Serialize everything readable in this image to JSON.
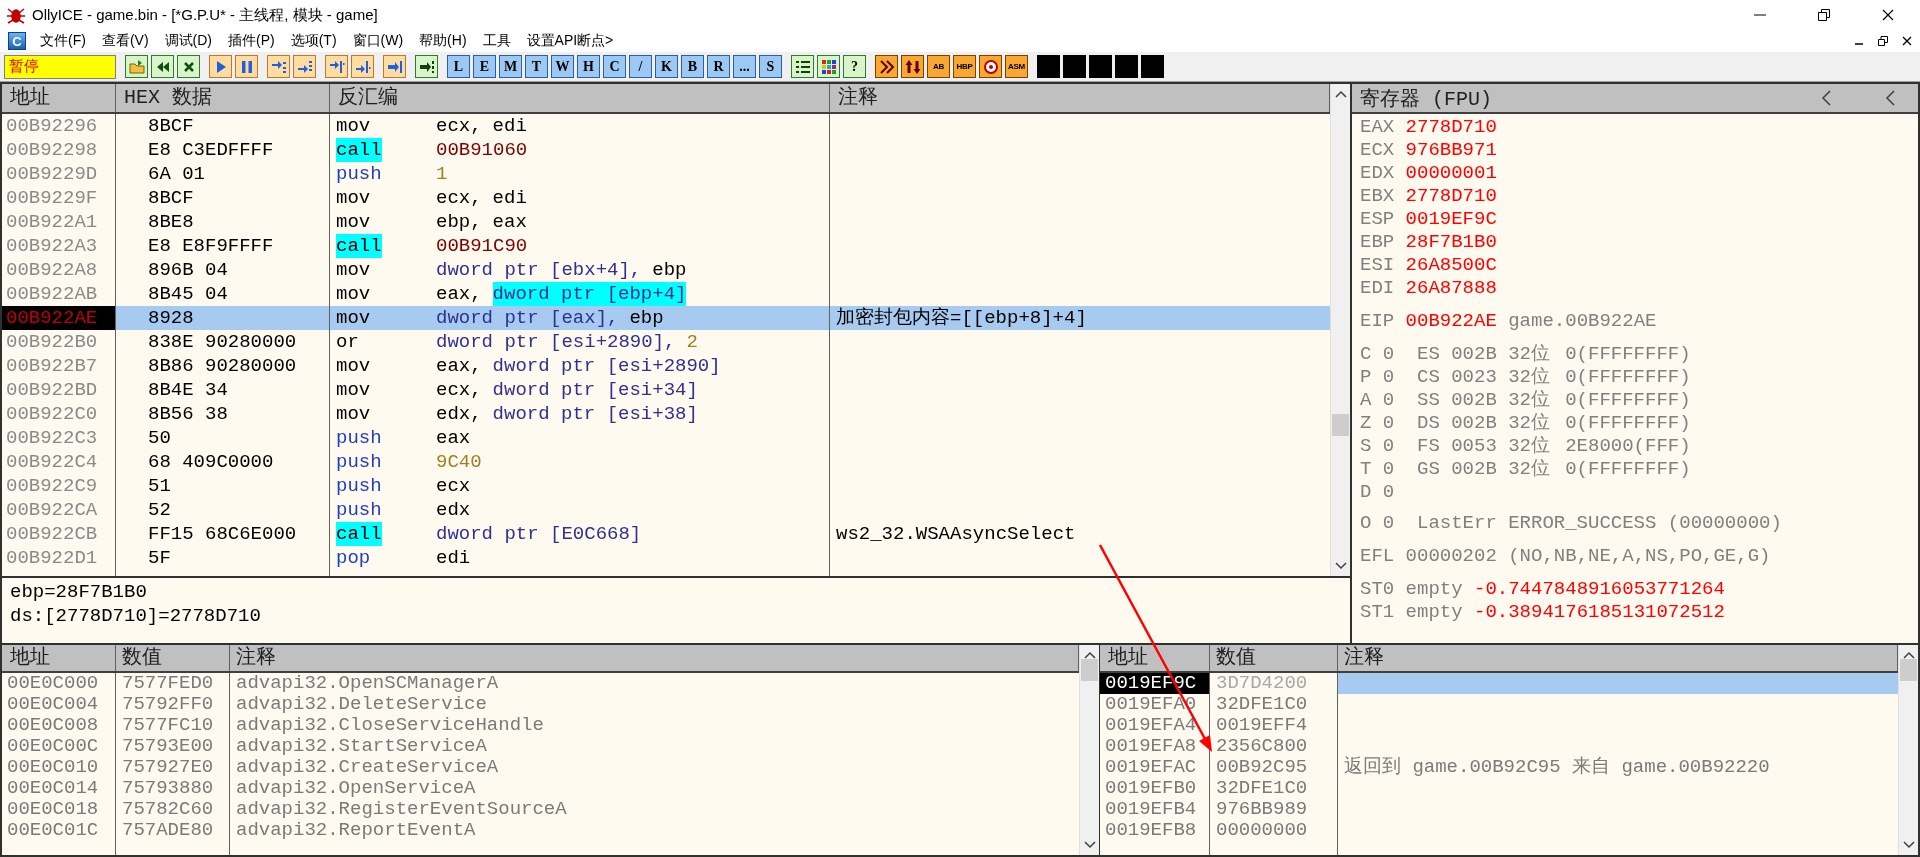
{
  "window": {
    "title": "OllyICE - game.bin - [*G.P.U* - 主线程, 模块 - game]"
  },
  "menu": {
    "window_icon_label": "C",
    "items": [
      {
        "label": "文件(F)"
      },
      {
        "label": "查看(V)"
      },
      {
        "label": "调试(D)"
      },
      {
        "label": "插件(P)"
      },
      {
        "label": "选项(T)"
      },
      {
        "label": "窗口(W)"
      },
      {
        "label": "帮助(H)"
      },
      {
        "label": "工具"
      },
      {
        "label": "设置API断点>"
      }
    ]
  },
  "toolbar": {
    "status": "暂停",
    "groups": [
      {
        "buttons": [
          {
            "kind": "icon"
          },
          {
            "kind": "icon"
          },
          {
            "kind": "icon"
          }
        ]
      },
      {
        "buttons": [
          {
            "kind": "icon"
          },
          {
            "kind": "icon"
          }
        ]
      },
      {
        "buttons": [
          {
            "kind": "icon"
          },
          {
            "kind": "icon"
          }
        ]
      },
      {
        "buttons": [
          {
            "kind": "icon"
          },
          {
            "kind": "icon"
          }
        ]
      },
      {
        "buttons": [
          {
            "kind": "icon"
          }
        ]
      },
      {
        "buttons": [
          {
            "kind": "icon"
          }
        ]
      },
      {
        "buttons": [
          {
            "kind": "letter",
            "label": "L"
          },
          {
            "kind": "letter",
            "label": "E"
          },
          {
            "kind": "letter",
            "label": "M"
          },
          {
            "kind": "letter",
            "label": "T"
          },
          {
            "kind": "letter",
            "label": "W"
          },
          {
            "kind": "letter",
            "label": "H"
          },
          {
            "kind": "letter",
            "label": "C"
          },
          {
            "kind": "letter",
            "label": "/"
          },
          {
            "kind": "letter",
            "label": "K"
          },
          {
            "kind": "letter",
            "label": "B"
          },
          {
            "kind": "letter",
            "label": "R"
          },
          {
            "kind": "letter",
            "label": "..."
          },
          {
            "kind": "letter",
            "label": "S"
          }
        ]
      },
      {
        "buttons": [
          {
            "kind": "icon"
          },
          {
            "kind": "icon"
          },
          {
            "kind": "letter",
            "label": "?"
          }
        ]
      },
      {
        "buttons": [
          {
            "kind": "icon"
          },
          {
            "kind": "icon"
          },
          {
            "kind": "small_letter",
            "label": "AB"
          },
          {
            "kind": "small_letter",
            "label": "HBP"
          },
          {
            "kind": "icon"
          },
          {
            "kind": "small_letter",
            "label": "ASM"
          }
        ]
      },
      {
        "buttons": [
          {
            "kind": "blank"
          },
          {
            "kind": "blank"
          },
          {
            "kind": "blank"
          },
          {
            "kind": "blank"
          },
          {
            "kind": "blank"
          }
        ]
      }
    ]
  },
  "disassembly": {
    "columns": [
      "地址",
      "HEX 数据",
      "反汇编",
      "注释"
    ],
    "rows": [
      {
        "address": "00B92296",
        "hex": "8BCF",
        "mnemonic": "mov",
        "kind": "plain",
        "operands": [
          {
            "text": "ecx,",
            "kind": "reg"
          },
          {
            "text": "edi",
            "kind": "reg"
          }
        ],
        "selected": false,
        "current": false
      },
      {
        "address": "00B92298",
        "hex": "E8 C3EDFFFF",
        "mnemonic": "call",
        "kind": "call",
        "operands": [
          {
            "text": "00B91060",
            "kind": "target"
          }
        ],
        "selected": false,
        "current": false
      },
      {
        "address": "00B9229D",
        "hex": "6A 01",
        "mnemonic": "push",
        "kind": "stack",
        "operands": [
          {
            "text": "1",
            "kind": "imm"
          }
        ],
        "selected": false,
        "current": false
      },
      {
        "address": "00B9229F",
        "hex": "8BCF",
        "mnemonic": "mov",
        "kind": "plain",
        "operands": [
          {
            "text": "ecx,",
            "kind": "reg"
          },
          {
            "text": "edi",
            "kind": "reg"
          }
        ],
        "selected": false,
        "current": false
      },
      {
        "address": "00B922A1",
        "hex": "8BE8",
        "mnemonic": "mov",
        "kind": "plain",
        "operands": [
          {
            "text": "ebp,",
            "kind": "reg"
          },
          {
            "text": "eax",
            "kind": "reg"
          }
        ],
        "selected": false,
        "current": false
      },
      {
        "address": "00B922A3",
        "hex": "E8 E8F9FFFF",
        "mnemonic": "call",
        "kind": "call",
        "operands": [
          {
            "text": "00B91C90",
            "kind": "target"
          }
        ],
        "selected": false,
        "current": false
      },
      {
        "address": "00B922A8",
        "hex": "896B 04",
        "mnemonic": "mov",
        "kind": "plain",
        "operands": [
          {
            "text": "dword ptr [ebx+4],",
            "kind": "mem"
          },
          {
            "text": "ebp",
            "kind": "reg"
          }
        ],
        "selected": false,
        "current": false
      },
      {
        "address": "00B922AB",
        "hex": "8B45 04",
        "mnemonic": "mov",
        "kind": "plain",
        "operands": [
          {
            "text": "eax,",
            "kind": "reg"
          },
          {
            "text": "dword ptr [ebp+4]",
            "kind": "mem",
            "highlight": true
          }
        ],
        "selected": false,
        "current": false
      },
      {
        "address": "00B922AE",
        "hex": "8928",
        "mnemonic": "mov",
        "kind": "plain",
        "operands": [
          {
            "text": "dword ptr [eax],",
            "kind": "mem"
          },
          {
            "text": "ebp",
            "kind": "reg"
          }
        ],
        "comment": "加密封包内容=[[ebp+8]+4]",
        "selected": true,
        "current": true
      },
      {
        "address": "00B922B0",
        "hex": "838E 90280000",
        "mnemonic": "or",
        "kind": "plain",
        "operands": [
          {
            "text": "dword ptr [esi+2890],",
            "kind": "mem"
          },
          {
            "text": "2",
            "kind": "imm"
          }
        ],
        "selected": false,
        "current": false
      },
      {
        "address": "00B922B7",
        "hex": "8B86 90280000",
        "mnemonic": "mov",
        "kind": "plain",
        "operands": [
          {
            "text": "eax,",
            "kind": "reg"
          },
          {
            "text": "dword ptr [esi+2890]",
            "kind": "mem"
          }
        ],
        "selected": false,
        "current": false
      },
      {
        "address": "00B922BD",
        "hex": "8B4E 34",
        "mnemonic": "mov",
        "kind": "plain",
        "operands": [
          {
            "text": "ecx,",
            "kind": "reg"
          },
          {
            "text": "dword ptr [esi+34]",
            "kind": "mem"
          }
        ],
        "selected": false,
        "current": false
      },
      {
        "address": "00B922C0",
        "hex": "8B56 38",
        "mnemonic": "mov",
        "kind": "plain",
        "operands": [
          {
            "text": "edx,",
            "kind": "reg"
          },
          {
            "text": "dword ptr [esi+38]",
            "kind": "mem"
          }
        ],
        "selected": false,
        "current": false
      },
      {
        "address": "00B922C3",
        "hex": "50",
        "mnemonic": "push",
        "kind": "stack",
        "operands": [
          {
            "text": "eax",
            "kind": "reg"
          }
        ],
        "selected": false,
        "current": false
      },
      {
        "address": "00B922C4",
        "hex": "68 409C0000",
        "mnemonic": "push",
        "kind": "stack",
        "operands": [
          {
            "text": "9C40",
            "kind": "imm"
          }
        ],
        "selected": false,
        "current": false
      },
      {
        "address": "00B922C9",
        "hex": "51",
        "mnemonic": "push",
        "kind": "stack",
        "operands": [
          {
            "text": "ecx",
            "kind": "reg"
          }
        ],
        "selected": false,
        "current": false
      },
      {
        "address": "00B922CA",
        "hex": "52",
        "mnemonic": "push",
        "kind": "stack",
        "operands": [
          {
            "text": "edx",
            "kind": "reg"
          }
        ],
        "selected": false,
        "current": false
      },
      {
        "address": "00B922CB",
        "hex": "FF15 68C6E000",
        "mnemonic": "call",
        "kind": "call",
        "operands": [
          {
            "text": "dword ptr [E0C668]",
            "kind": "mem"
          }
        ],
        "comment": "ws2_32.WSAAsyncSelect",
        "selected": false,
        "current": false
      },
      {
        "address": "00B922D1",
        "hex": "5F",
        "mnemonic": "pop",
        "kind": "stack",
        "operands": [
          {
            "text": "edi",
            "kind": "reg"
          }
        ],
        "selected": false,
        "current": false
      }
    ]
  },
  "info": {
    "lines": [
      "ebp=28F7B1B0",
      "ds:[2778D710]=2778D710"
    ]
  },
  "registers": {
    "title": "寄存器 (FPU)",
    "general": [
      {
        "name": "EAX",
        "value": "2778D710",
        "changed": true
      },
      {
        "name": "ECX",
        "value": "976BB971",
        "changed": true
      },
      {
        "name": "EDX",
        "value": "00000001",
        "changed": true
      },
      {
        "name": "EBX",
        "value": "2778D710",
        "changed": true
      },
      {
        "name": "ESP",
        "value": "0019EF9C",
        "changed": true
      },
      {
        "name": "EBP",
        "value": "28F7B1B0",
        "changed": true
      },
      {
        "name": "ESI",
        "value": "26A8500C",
        "changed": true
      },
      {
        "name": "EDI",
        "value": "26A87888",
        "changed": true
      }
    ],
    "eip": {
      "name": "EIP",
      "value": "00B922AE",
      "changed": true,
      "note": "game.00B922AE"
    },
    "flags": [
      {
        "kind": "segment",
        "flag": "C",
        "value": "0",
        "segment": "ES",
        "selector": "002B",
        "bits": "32位",
        "limit": "0(FFFFFFFF)"
      },
      {
        "kind": "segment",
        "flag": "P",
        "value": "0",
        "segment": "CS",
        "selector": "0023",
        "bits": "32位",
        "limit": "0(FFFFFFFF)"
      },
      {
        "kind": "segment",
        "flag": "A",
        "value": "0",
        "segment": "SS",
        "selector": "002B",
        "bits": "32位",
        "limit": "0(FFFFFFFF)"
      },
      {
        "kind": "segment",
        "flag": "Z",
        "value": "0",
        "segment": "DS",
        "selector": "002B",
        "bits": "32位",
        "limit": "0(FFFFFFFF)"
      },
      {
        "kind": "segment",
        "flag": "S",
        "value": "0",
        "segment": "FS",
        "selector": "0053",
        "bits": "32位",
        "limit": "2E8000(FFF)"
      },
      {
        "kind": "segment",
        "flag": "T",
        "value": "0",
        "segment": "GS",
        "selector": "002B",
        "bits": "32位",
        "limit": "0(FFFFFFFF)"
      },
      {
        "kind": "plain",
        "flag": "D",
        "value": "0"
      },
      {
        "kind": "last_error",
        "flag": "O",
        "value": "0",
        "label": "LastErr",
        "error": "ERROR_SUCCESS (00000000)"
      }
    ],
    "efl": {
      "name": "EFL",
      "value": "00000202",
      "changed": false,
      "note": "(NO,NB,NE,A,NS,PO,GE,G)"
    },
    "fpu": [
      {
        "name": "ST0",
        "tag": "empty",
        "value": "-0.7447848916053771264",
        "changed": true
      },
      {
        "name": "ST1",
        "tag": "empty",
        "value": "-0.3894176185131072512",
        "changed": true
      }
    ]
  },
  "dump": {
    "columns": [
      "地址",
      "数值",
      "注释"
    ],
    "rows": [
      {
        "address": "00E0C000",
        "value": "7577FED0",
        "comment": "advapi32.OpenSCManagerA"
      },
      {
        "address": "00E0C004",
        "value": "75792FF0",
        "comment": "advapi32.DeleteService"
      },
      {
        "address": "00E0C008",
        "value": "7577FC10",
        "comment": "advapi32.CloseServiceHandle"
      },
      {
        "address": "00E0C00C",
        "value": "75793E00",
        "comment": "advapi32.StartServiceA"
      },
      {
        "address": "00E0C010",
        "value": "757927E0",
        "comment": "advapi32.CreateServiceA"
      },
      {
        "address": "00E0C014",
        "value": "75793880",
        "comment": "advapi32.OpenServiceA"
      },
      {
        "address": "00E0C018",
        "value": "75782C60",
        "comment": "advapi32.RegisterEventSourceA"
      },
      {
        "address": "00E0C01C",
        "value": "757ADE80",
        "comment": "advapi32.ReportEventA"
      }
    ]
  },
  "stack": {
    "columns": [
      "地址",
      "数值",
      "注释"
    ],
    "rows": [
      {
        "address": "0019EF9C",
        "value": "3D7D4200",
        "selected": true
      },
      {
        "address": "0019EFA0",
        "value": "32DFE1C0",
        "selected": false
      },
      {
        "address": "0019EFA4",
        "value": "0019EFF4",
        "selected": false
      },
      {
        "address": "0019EFA8",
        "value": "2356C800",
        "selected": false
      },
      {
        "address": "0019EFAC",
        "value": "00B92C95",
        "comment": "返回到 game.00B92C95 来自 game.00B92220",
        "selected": false
      },
      {
        "address": "0019EFB0",
        "value": "32DFE1C0",
        "selected": false
      },
      {
        "address": "0019EFB4",
        "value": "976BB989",
        "selected": false
      },
      {
        "address": "0019EFB8",
        "value": "00000000",
        "selected": false
      }
    ]
  }
}
